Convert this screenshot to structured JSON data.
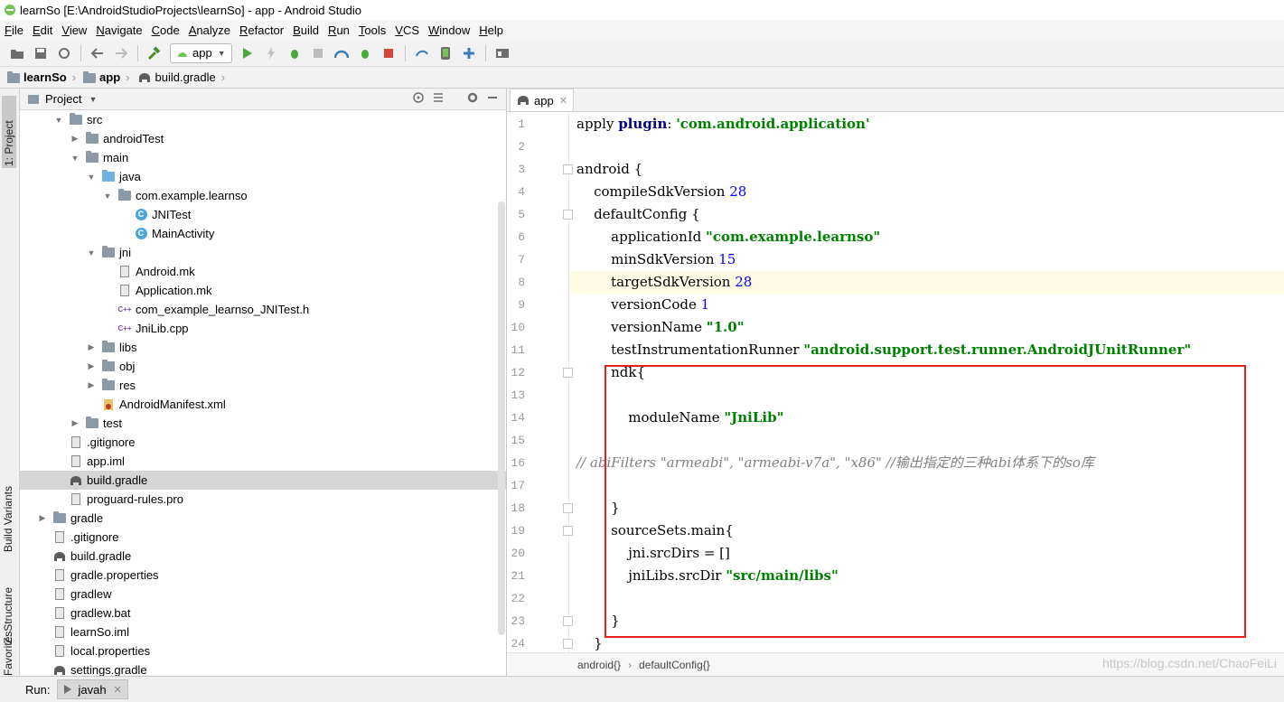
{
  "window": {
    "title": "learnSo [E:\\AndroidStudioProjects\\learnSo] - app - Android Studio"
  },
  "menu": [
    "File",
    "Edit",
    "View",
    "Navigate",
    "Code",
    "Analyze",
    "Refactor",
    "Build",
    "Run",
    "Tools",
    "VCS",
    "Window",
    "Help"
  ],
  "toolbar": {
    "run_config": "app"
  },
  "breadcrumb": [
    "learnSo",
    "app",
    "build.gradle"
  ],
  "side_tabs": {
    "project": "1: Project",
    "build_variants": "Build Variants",
    "structure": "Z: Structure",
    "favorites": "Favorites"
  },
  "project_panel": {
    "header": "Project",
    "tree": [
      {
        "label": "src",
        "depth": 2,
        "type": "folder",
        "open": true
      },
      {
        "label": "androidTest",
        "depth": 3,
        "type": "folder",
        "open": false
      },
      {
        "label": "main",
        "depth": 3,
        "type": "folder",
        "open": true
      },
      {
        "label": "java",
        "depth": 4,
        "type": "folder-blue",
        "open": true
      },
      {
        "label": "com.example.learnso",
        "depth": 5,
        "type": "folder",
        "open": true
      },
      {
        "label": "JNITest",
        "depth": 6,
        "type": "class"
      },
      {
        "label": "MainActivity",
        "depth": 6,
        "type": "class"
      },
      {
        "label": "jni",
        "depth": 4,
        "type": "folder",
        "open": true
      },
      {
        "label": "Android.mk",
        "depth": 5,
        "type": "file"
      },
      {
        "label": "Application.mk",
        "depth": 5,
        "type": "file"
      },
      {
        "label": "com_example_learnso_JNITest.h",
        "depth": 5,
        "type": "cpp"
      },
      {
        "label": "JniLib.cpp",
        "depth": 5,
        "type": "cpp"
      },
      {
        "label": "libs",
        "depth": 4,
        "type": "folder",
        "open": false
      },
      {
        "label": "obj",
        "depth": 4,
        "type": "folder",
        "open": false
      },
      {
        "label": "res",
        "depth": 4,
        "type": "folder",
        "open": false
      },
      {
        "label": "AndroidManifest.xml",
        "depth": 4,
        "type": "manifest"
      },
      {
        "label": "test",
        "depth": 3,
        "type": "folder",
        "open": false
      },
      {
        "label": ".gitignore",
        "depth": 2,
        "type": "file"
      },
      {
        "label": "app.iml",
        "depth": 2,
        "type": "file"
      },
      {
        "label": "build.gradle",
        "depth": 2,
        "type": "gradle",
        "selected": true
      },
      {
        "label": "proguard-rules.pro",
        "depth": 2,
        "type": "file"
      },
      {
        "label": "gradle",
        "depth": 1,
        "type": "folder",
        "open": false
      },
      {
        "label": ".gitignore",
        "depth": 1,
        "type": "file"
      },
      {
        "label": "build.gradle",
        "depth": 1,
        "type": "gradle"
      },
      {
        "label": "gradle.properties",
        "depth": 1,
        "type": "file"
      },
      {
        "label": "gradlew",
        "depth": 1,
        "type": "file"
      },
      {
        "label": "gradlew.bat",
        "depth": 1,
        "type": "file"
      },
      {
        "label": "learnSo.iml",
        "depth": 1,
        "type": "file"
      },
      {
        "label": "local.properties",
        "depth": 1,
        "type": "file"
      },
      {
        "label": "settings.gradle",
        "depth": 1,
        "type": "gradle"
      }
    ]
  },
  "editor": {
    "tab": "app",
    "lines": [
      {
        "n": "1",
        "html": "apply <span class=\"kw\">plugin</span>: <span class=\"str\">'com.android.application'</span>"
      },
      {
        "n": "2",
        "html": ""
      },
      {
        "n": "3",
        "html": "android {"
      },
      {
        "n": "4",
        "html": "    compileSdkVersion <span class=\"num\">28</span>"
      },
      {
        "n": "5",
        "html": "    defaultConfig {"
      },
      {
        "n": "6",
        "html": "        applicationId <span class=\"str\">\"com.example.learnso\"</span>"
      },
      {
        "n": "7",
        "html": "        minSdkVersion <span class=\"num\">15</span>"
      },
      {
        "n": "8",
        "html": "        targetSdkVersion <span class=\"num\">28</span>",
        "hl": true
      },
      {
        "n": "9",
        "html": "        versionCode <span class=\"num\">1</span>"
      },
      {
        "n": "10",
        "html": "        versionName <span class=\"str\">\"1.0\"</span>"
      },
      {
        "n": "11",
        "html": "        testInstrumentationRunner <span class=\"str\">\"android.support.test.runner.AndroidJUnitRunner\"</span>"
      },
      {
        "n": "12",
        "html": "        ndk{"
      },
      {
        "n": "13",
        "html": ""
      },
      {
        "n": "14",
        "html": "            moduleName <span class=\"str\">\"JniLib\"</span>"
      },
      {
        "n": "15",
        "html": ""
      },
      {
        "n": "16",
        "html": "<span class=\"cmt\">// abiFilters \"armeabi\", \"armeabi-v7a\", \"x86\" //输出指定的三种abi体系下的so库</span>"
      },
      {
        "n": "17",
        "html": ""
      },
      {
        "n": "18",
        "html": "        }"
      },
      {
        "n": "19",
        "html": "        sourceSets.main{"
      },
      {
        "n": "20",
        "html": "            jni.srcDirs = []"
      },
      {
        "n": "21",
        "html": "            jniLibs.srcDir <span class=\"str\">\"src/main/libs\"</span>"
      },
      {
        "n": "22",
        "html": ""
      },
      {
        "n": "23",
        "html": "        }"
      },
      {
        "n": "24",
        "html": "    }"
      }
    ],
    "breadcrumb": [
      "android{}",
      "defaultConfig{}"
    ]
  },
  "watermark": "https://blog.csdn.net/ChaoFeiLi",
  "bottom": {
    "run_label": "Run:",
    "tab": "javah"
  }
}
